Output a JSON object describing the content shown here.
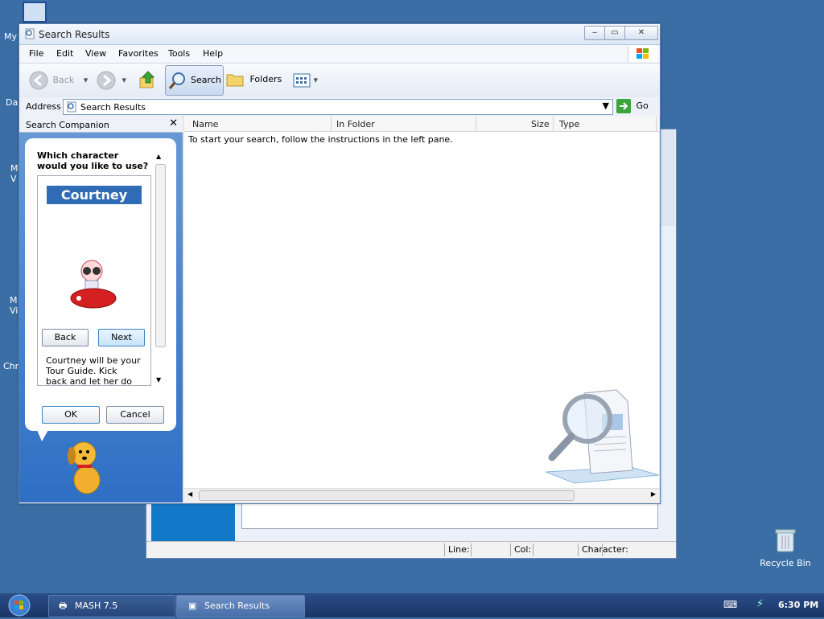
{
  "desktop": {
    "icon_labels": [
      "My",
      "Da",
      "M\nV",
      "M\nVi",
      "Chr"
    ],
    "recycle_bin_label": "Recycle Bin"
  },
  "back_window": {
    "status": {
      "line_label": "Line:",
      "col_label": "Col:",
      "char_label": "Character:"
    }
  },
  "window": {
    "title": "Search Results",
    "controls": {
      "minimize": "▭",
      "maximize": "▭",
      "close": "✕"
    },
    "menu": [
      "File",
      "Edit",
      "View",
      "Favorites",
      "Tools",
      "Help"
    ],
    "toolbar": {
      "back": "Back",
      "search": "Search",
      "folders": "Folders"
    },
    "address": {
      "label": "Address",
      "value": "Search Results",
      "go": "Go"
    }
  },
  "companion": {
    "header": "Search Companion",
    "question": "Which character would you like to use?",
    "character_name": "Courtney",
    "back_button": "Back",
    "next_button": "Next",
    "description": "Courtney will be your Tour Guide. Kick back and let her do the",
    "ok_button": "OK",
    "cancel_button": "Cancel"
  },
  "results": {
    "columns": [
      "Name",
      "In Folder",
      "Size",
      "Type"
    ],
    "message": "To start your search, follow the instructions in the left pane."
  },
  "taskbar": {
    "tasks": [
      "MASH 7.5",
      "Search Results"
    ],
    "clock": "6:30 PM"
  },
  "colors": {
    "desktop": "#3a6ea5",
    "accent": "#2f6cb5",
    "taskbar": "#1b3566"
  }
}
